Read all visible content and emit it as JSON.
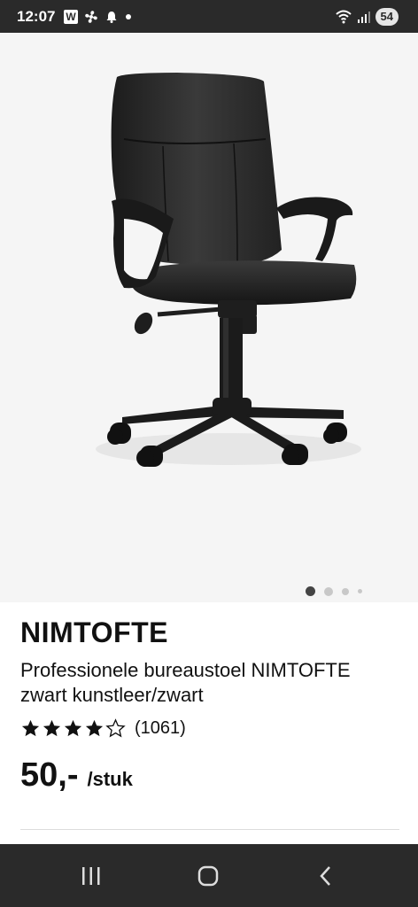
{
  "status_bar": {
    "time": "12:07",
    "battery": "54",
    "app_badge": "W"
  },
  "gallery": {
    "image_alt": "Office chair NIMTOFTE product photo",
    "pagination": {
      "total": 4,
      "active_index": 0
    }
  },
  "product": {
    "name": "NIMTOFTE",
    "description": "Professionele bureaustoel NIMTOFTE zwart kunstleer/zwart",
    "rating": {
      "value": 4,
      "max": 5,
      "count_label": "(1061)"
    },
    "price": "50,-",
    "unit": "/stuk"
  },
  "colors": {
    "status_bar_bg": "#2a2a2a",
    "image_bg": "#f5f5f5",
    "text": "#111111"
  },
  "nav": {
    "icons": [
      "recent-apps-icon",
      "home-icon",
      "back-icon"
    ]
  }
}
